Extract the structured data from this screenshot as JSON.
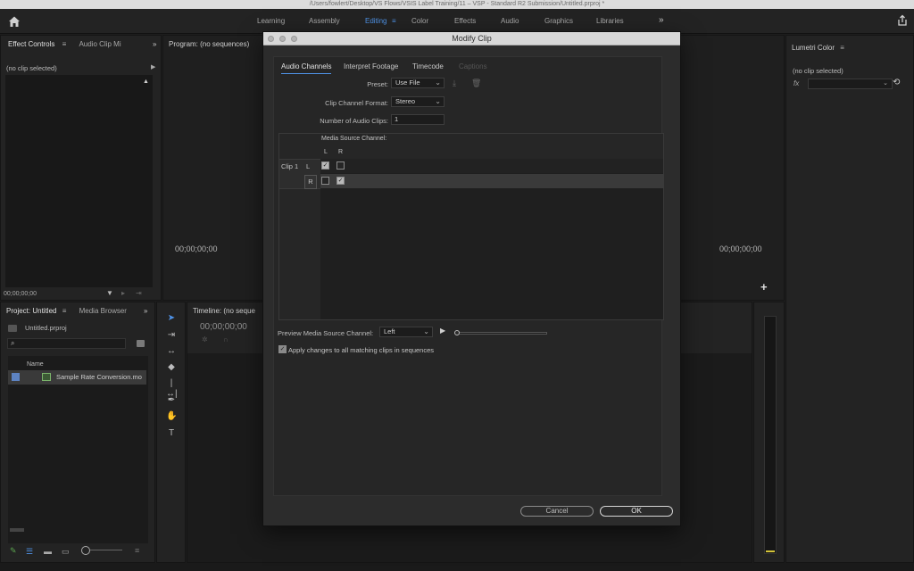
{
  "window": {
    "title": "/Users/fowlert/Desktop/VS Flows/VSIS Label Training/11 – VSP - Standard R2 Submission/Untitled.prproj *"
  },
  "workspaces": {
    "tabs": [
      "Learning",
      "Assembly",
      "Editing",
      "Color",
      "Effects",
      "Audio",
      "Graphics",
      "Libraries"
    ],
    "active": "Editing",
    "more": "»",
    "editing_menu_icon": "≡"
  },
  "effect_controls": {
    "tab1": "Effect Controls",
    "tab2": "Audio Clip Mi",
    "no_clip": "(no clip selected)",
    "timecode": "00;00;00;00",
    "more": "»"
  },
  "program": {
    "title": "Program: (no sequences)",
    "tc_left": "00;00;00;00",
    "tc_right": "00;00;00;00",
    "add": "+"
  },
  "lumetri": {
    "title": "Lumetri Color",
    "no_clip": "(no clip selected)",
    "fx": "fx"
  },
  "project": {
    "tab1": "Project: Untitled",
    "tab2": "Media Browser",
    "more": "»",
    "file": "Untitled.prproj",
    "col_name": "Name",
    "item": "Sample Rate Conversion.mo"
  },
  "timeline": {
    "title": "Timeline: (no seque",
    "timecode": "00;00;00;00"
  },
  "modal": {
    "title": "Modify Clip",
    "tabs": {
      "audio_channels": "Audio Channels",
      "interpret_footage": "Interpret Footage",
      "timecode": "Timecode",
      "captions": "Captions"
    },
    "preset_label": "Preset:",
    "preset_value": "Use File",
    "format_label": "Clip Channel Format:",
    "format_value": "Stereo",
    "num_clips_label": "Number of Audio Clips:",
    "num_clips_value": "1",
    "media_source_label": "Media Source Channel:",
    "col_l": "L",
    "col_r": "R",
    "clip_label": "Clip 1",
    "row_l": "L",
    "row_r": "R",
    "preview_label": "Preview Media Source Channel:",
    "preview_value": "Left",
    "apply_label": "Apply changes to all matching clips in sequences",
    "cancel": "Cancel",
    "ok": "OK"
  }
}
